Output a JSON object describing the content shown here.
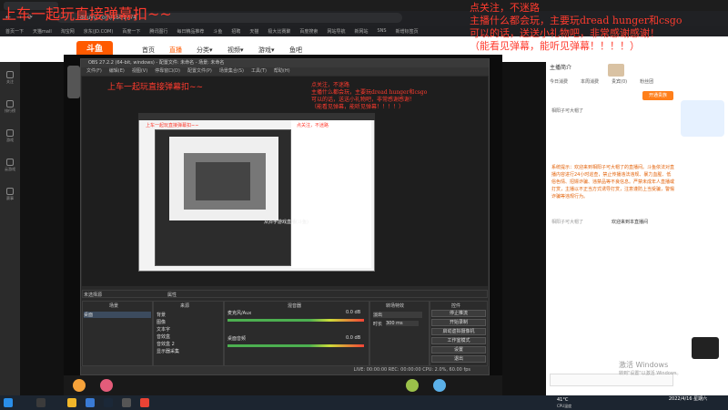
{
  "browser": {
    "url": "douyu.com/1501774",
    "bookmarks": [
      "首页一下",
      "天猫mall",
      "淘宝网",
      "京东(JD.COM)",
      "百度一下",
      "腾讯图行",
      "每日精品推荐",
      "斗鱼",
      "招聘",
      "天猫",
      "极大比赛聚",
      "百度搜索",
      "网站导航",
      "新网站",
      "SNS",
      "新增标签页"
    ]
  },
  "site": {
    "logo": "斗鱼",
    "nav": [
      "首页",
      "直播",
      "分类▾",
      "视频▾",
      "游戏▾",
      "鱼吧"
    ]
  },
  "leftrail": [
    "关注",
    "排行榜",
    "游戏",
    "云游戏",
    "赛事",
    "鱼吧"
  ],
  "overlay": {
    "title": "上车一起玩直接弹幕扣~~",
    "right_lines": [
      "点关注，不迷路",
      "主播什么都会玩，主要玩dread hunger和csgo",
      "可以的话，送送小礼物吧，非常感谢感谢！",
      "（能看见弹幕，能听见弹幕！！！！）"
    ]
  },
  "obs": {
    "title": "OBS 27.2.2 (64-bit, windows) - 配置文件: 未命名 - 场景: 未命名",
    "menu": [
      "文件(F)",
      "编辑(E)",
      "视图(V)",
      "停靠窗口(D)",
      "配置文件(P)",
      "场景集合(S)",
      "工具(T)",
      "帮助(H)"
    ],
    "docks": {
      "scenes": "场景",
      "sources": "来源",
      "mixer": "混音器",
      "transitions": "转场特效",
      "controls": "控件"
    },
    "scene_list": [
      "桌面"
    ],
    "sources": [
      "背景",
      "图像",
      "文本字",
      "音效盒",
      "音效盒 2",
      "显示器采集"
    ],
    "mixer": [
      {
        "name": "麦克风/Aux",
        "level": "0.0 dB"
      },
      {
        "name": "桌面音频",
        "level": "0.0 dB"
      }
    ],
    "transition": {
      "type": "淡出",
      "duration_label": "时长",
      "duration": "300 ms"
    },
    "buttons": [
      "停止推流",
      "开始录制",
      "启动虚拟摄像机",
      "工作室模式",
      "设置",
      "退出"
    ],
    "status": "LIVE: 00:00:00   REC: 00:00:00   CPU: 2.0%, 60.00 fps",
    "preview_label": "未选择源",
    "filters_label": "属性",
    "nested_caption": "从抖手游戏直播(斗鱼)"
  },
  "panel": {
    "streamer": "主播简介",
    "tabs": [
      "今日消费",
      "本周消费",
      "贵宾(0)",
      "粉丝团"
    ],
    "rank_button": "开通贵族",
    "first_note": "相阳子可大帽了",
    "system_msg": "系统提示：欢迎来到相阳子可大帽了的直播间。斗鱼依法对直播内容进行24小时巡查，禁止传播违法违规、暴力血腥、低俗色情、招嫖诈骗、违禁品等不良信息。严禁未成年人直播或打赏，主播以不正当方式诱导打赏，注意谨防上当受骗，警惕诈骗等违规行为。",
    "welcome": "欢迎来到本直播间",
    "user_msg": "相阳子可大帽了"
  },
  "windows": {
    "activate_title": "激活 Windows",
    "activate_sub": "转到\"设置\"以激活 Windows。",
    "weather": "41°C",
    "weather_sub": "CPU温度",
    "time": "",
    "date": "2022/4/16 星期六"
  },
  "colors": {
    "overlay_red": "#ff3b2e",
    "douyu_orange": "#ff5a00"
  }
}
